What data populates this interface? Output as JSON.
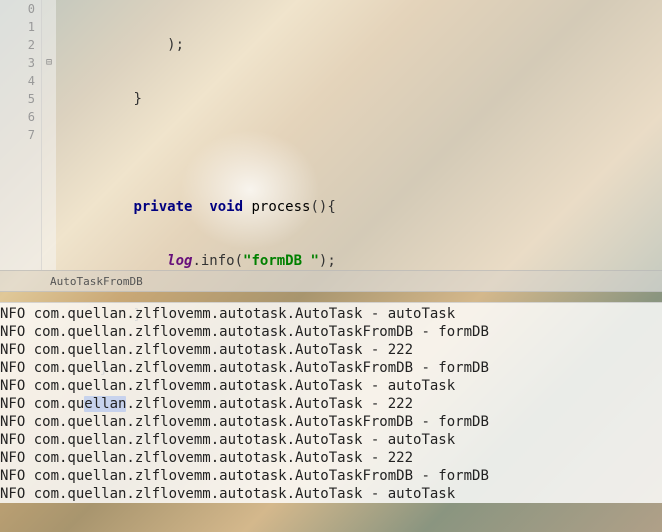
{
  "editor": {
    "gutter": {
      "line0": "0",
      "line1": "1",
      "line2": "2",
      "line3": "3",
      "line4": "4",
      "line5": "5",
      "line6": "6",
      "line7": "7"
    },
    "code": {
      "l1_indent": "            ",
      "l1_paren": ");",
      "l2_indent": "        ",
      "l2_brace": "}",
      "l4_indent": "        ",
      "l4_kw1": "private",
      "l4_sp1": "  ",
      "l4_kw2": "void",
      "l4_sp2": " ",
      "l4_method": "process",
      "l4_paren": "(){",
      "l5_indent": "            ",
      "l5_log": "log",
      "l5_dot": ".info(",
      "l5_str": "\"formDB \"",
      "l5_end": ");",
      "l6_indent": "        ",
      "l6_brace": "}",
      "l7_indent": "    ",
      "l7_brace": "}"
    }
  },
  "breadcrumb": {
    "item1": "AutoTaskFromDB"
  },
  "console": {
    "lines": [
      {
        "level": "NFO ",
        "pkg": "com.quellan.zlflovemm.autotask.AutoTask - autoTask"
      },
      {
        "level": "NFO ",
        "pkg": "com.quellan.zlflovemm.autotask.AutoTaskFromDB - formDB"
      },
      {
        "level": "NFO ",
        "pkg": "com.quellan.zlflovemm.autotask.AutoTask - 222"
      },
      {
        "level": "NFO ",
        "pkg": "com.quellan.zlflovemm.autotask.AutoTaskFromDB - formDB"
      },
      {
        "level": "NFO ",
        "pkg": "com.quellan.zlflovemm.autotask.AutoTask - autoTask"
      },
      {
        "level": "NFO ",
        "pkg_pre": "com.qu",
        "pkg_sel": "ellan",
        "pkg_post": ".zlflovemm.autotask.AutoTask - 222",
        "has_selection": true
      },
      {
        "level": "NFO ",
        "pkg": "com.quellan.zlflovemm.autotask.AutoTaskFromDB - formDB"
      },
      {
        "level": "NFO ",
        "pkg": "com.quellan.zlflovemm.autotask.AutoTask - autoTask"
      },
      {
        "level": "NFO ",
        "pkg": "com.quellan.zlflovemm.autotask.AutoTask - 222"
      },
      {
        "level": "NFO ",
        "pkg": "com.quellan.zlflovemm.autotask.AutoTaskFromDB - formDB"
      },
      {
        "level": "NFO ",
        "pkg": "com.quellan.zlflovemm.autotask.AutoTask - autoTask"
      }
    ]
  }
}
